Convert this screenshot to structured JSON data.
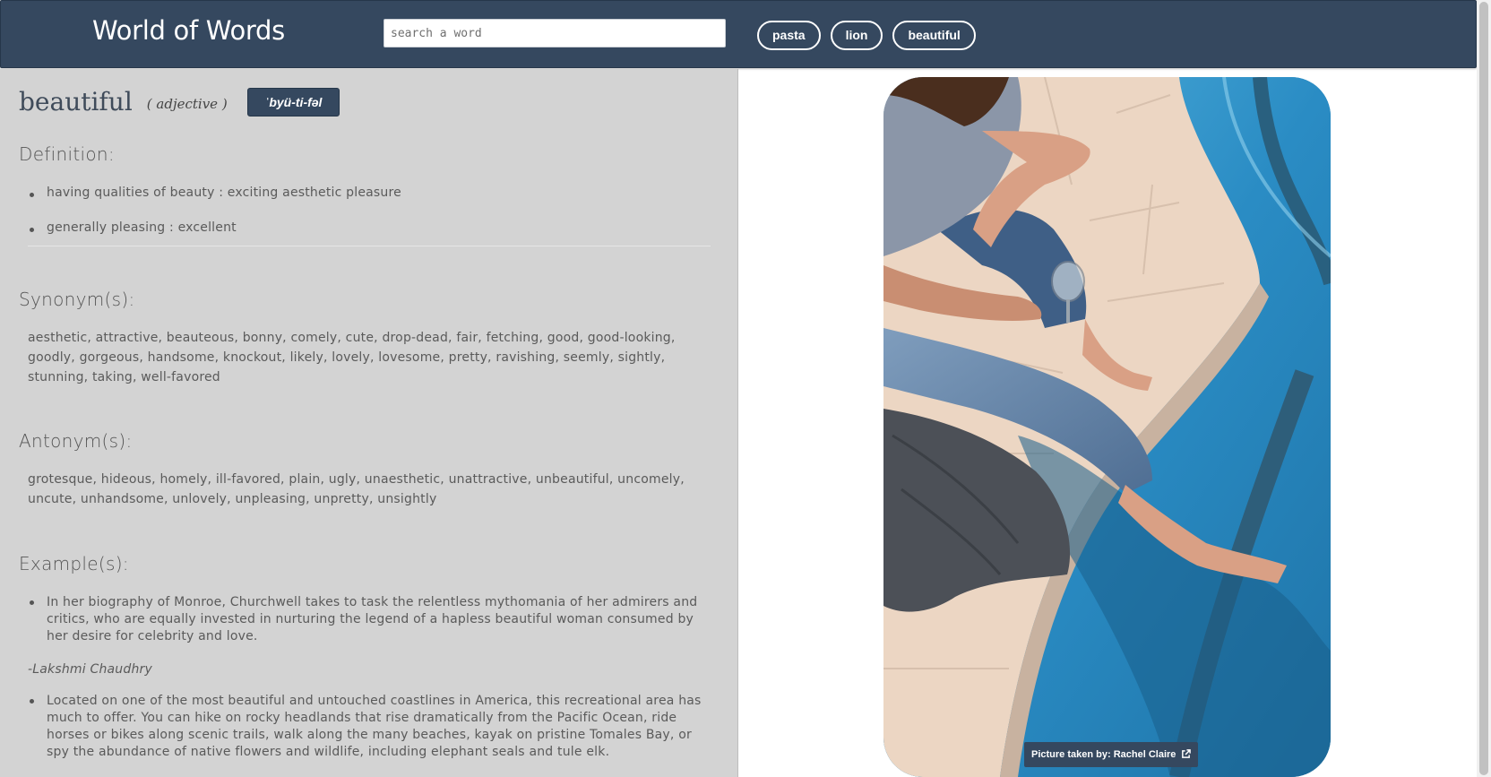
{
  "header": {
    "title": "World of Words",
    "search_placeholder": "search a word",
    "chips": [
      "pasta",
      "lion",
      "beautiful"
    ]
  },
  "entry": {
    "word": "beautiful",
    "part_of_speech": "( adjective )",
    "pronunciation": "ˈbyü-ti-fəl",
    "definition_title": "Definition:",
    "definitions": [
      "having qualities of beauty : exciting aesthetic pleasure",
      "generally pleasing : excellent"
    ],
    "synonyms_title": "Synonym(s):",
    "synonyms": "aesthetic, attractive, beauteous, bonny, comely, cute, drop-dead, fair, fetching, good, good-looking, goodly, gorgeous, handsome, knockout, likely, lovely, lovesome, pretty, ravishing, seemly, sightly, stunning, taking, well-favored",
    "antonyms_title": "Antonym(s):",
    "antonyms": "grotesque, hideous, homely, ill-favored, plain, ugly, unaesthetic, unattractive, unbeautiful, uncomely, uncute, unhandsome, unlovely, unpleasing, unpretty, unsightly",
    "examples_title": "Example(s):",
    "examples": [
      {
        "text": "In her biography of Monroe, Churchwell takes to task the relentless mythomania of her admirers and critics, who are equally invested in nurturing the legend of a hapless beautiful woman consumed by her desire for celebrity and love.",
        "author": "-Lakshmi Chaudhry"
      },
      {
        "text": "Located on one of the most beautiful and untouched coastlines in America, this recreational area has much to offer. You can hike on rocky headlands that rise dramatically from the Pacific Ocean, ride horses or bikes along scenic trails, walk along the many beaches, kayak on pristine Tomales Bay, or spy the abundance of native flowers and wildlife, including elephant seals and tule elk."
      }
    ]
  },
  "photo": {
    "credit": "Picture taken by: Rachel Claire",
    "credit_icon": "external-link-icon"
  },
  "colors": {
    "header_bg": "#35485f",
    "panel_bg": "#d3d3d3",
    "water": "#2f86b8",
    "deck": "#ecd6c3"
  }
}
